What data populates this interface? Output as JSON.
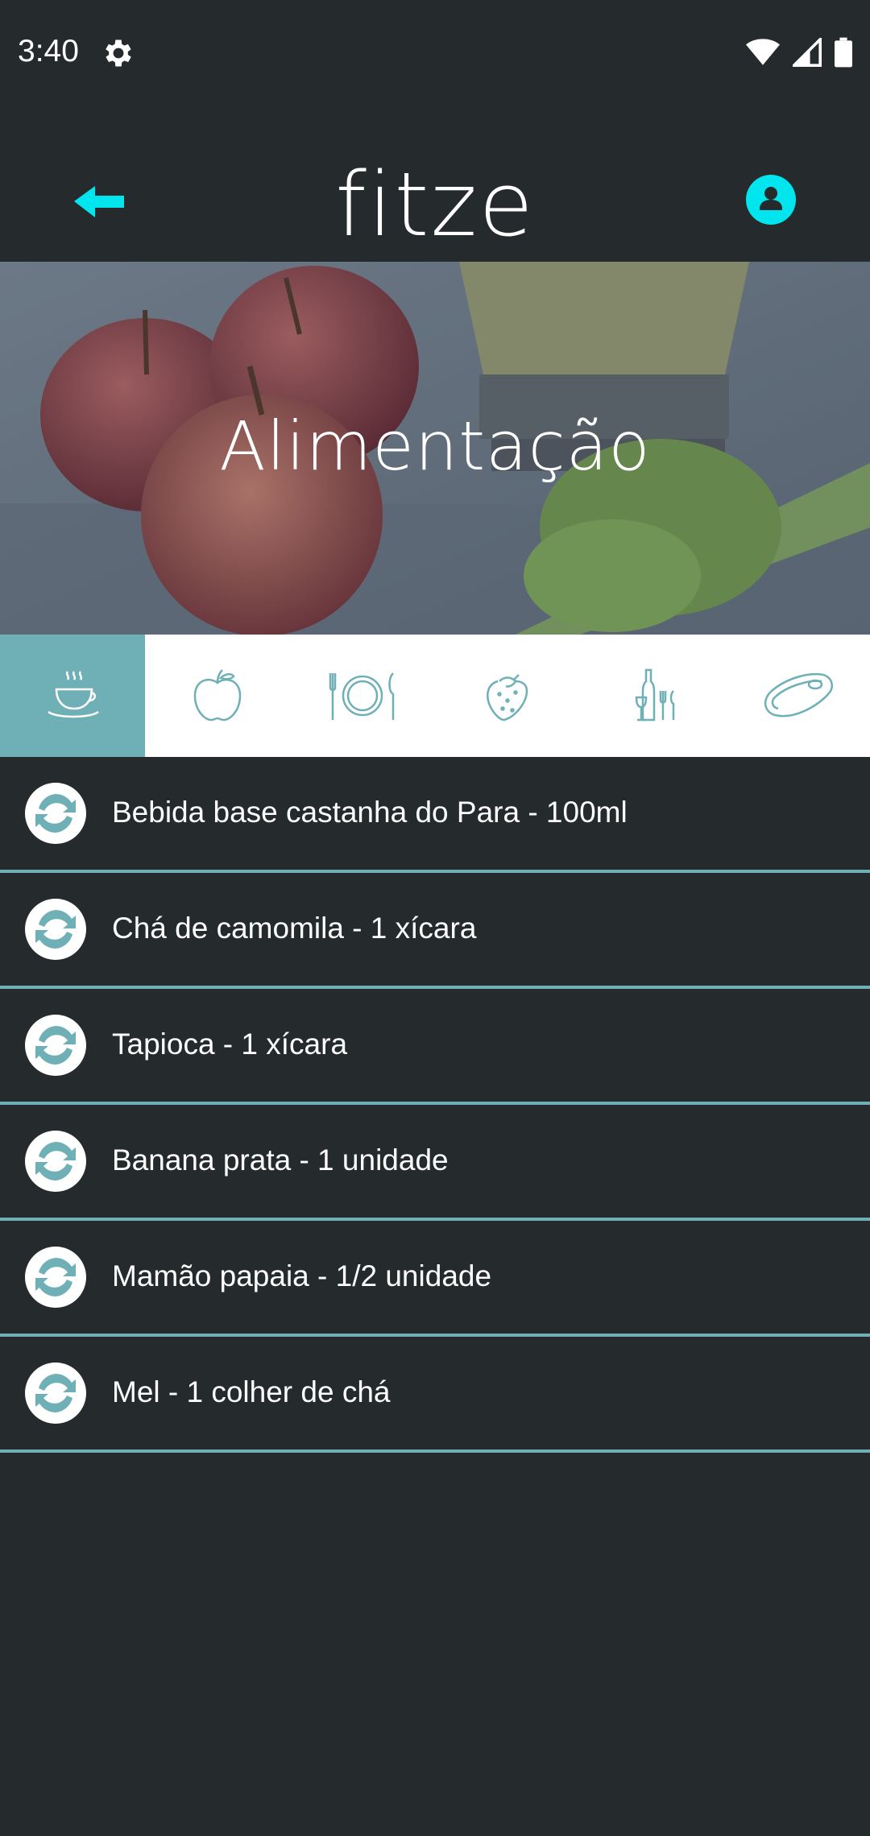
{
  "status": {
    "time": "3:40"
  },
  "app": {
    "logo": "fitze"
  },
  "hero": {
    "title": "Alimentação"
  },
  "tabs": [
    {
      "icon": "coffee-cup-icon",
      "active": true
    },
    {
      "icon": "apple-icon",
      "active": false
    },
    {
      "icon": "plate-cutlery-icon",
      "active": false
    },
    {
      "icon": "strawberry-icon",
      "active": false
    },
    {
      "icon": "wine-cutlery-icon",
      "active": false
    },
    {
      "icon": "steak-icon",
      "active": false
    }
  ],
  "items": [
    {
      "label": "Bebida base castanha do Para - 100ml"
    },
    {
      "label": "Chá de camomila - 1 xícara"
    },
    {
      "label": "Tapioca - 1 xícara"
    },
    {
      "label": "Banana prata - 1 unidade"
    },
    {
      "label": "Mamão papaia - 1/2 unidade"
    },
    {
      "label": "Mel - 1 colher de chá"
    }
  ],
  "colors": {
    "background": "#252a2c",
    "accent": "#6fb0b7",
    "cyan": "#00e5ee"
  }
}
